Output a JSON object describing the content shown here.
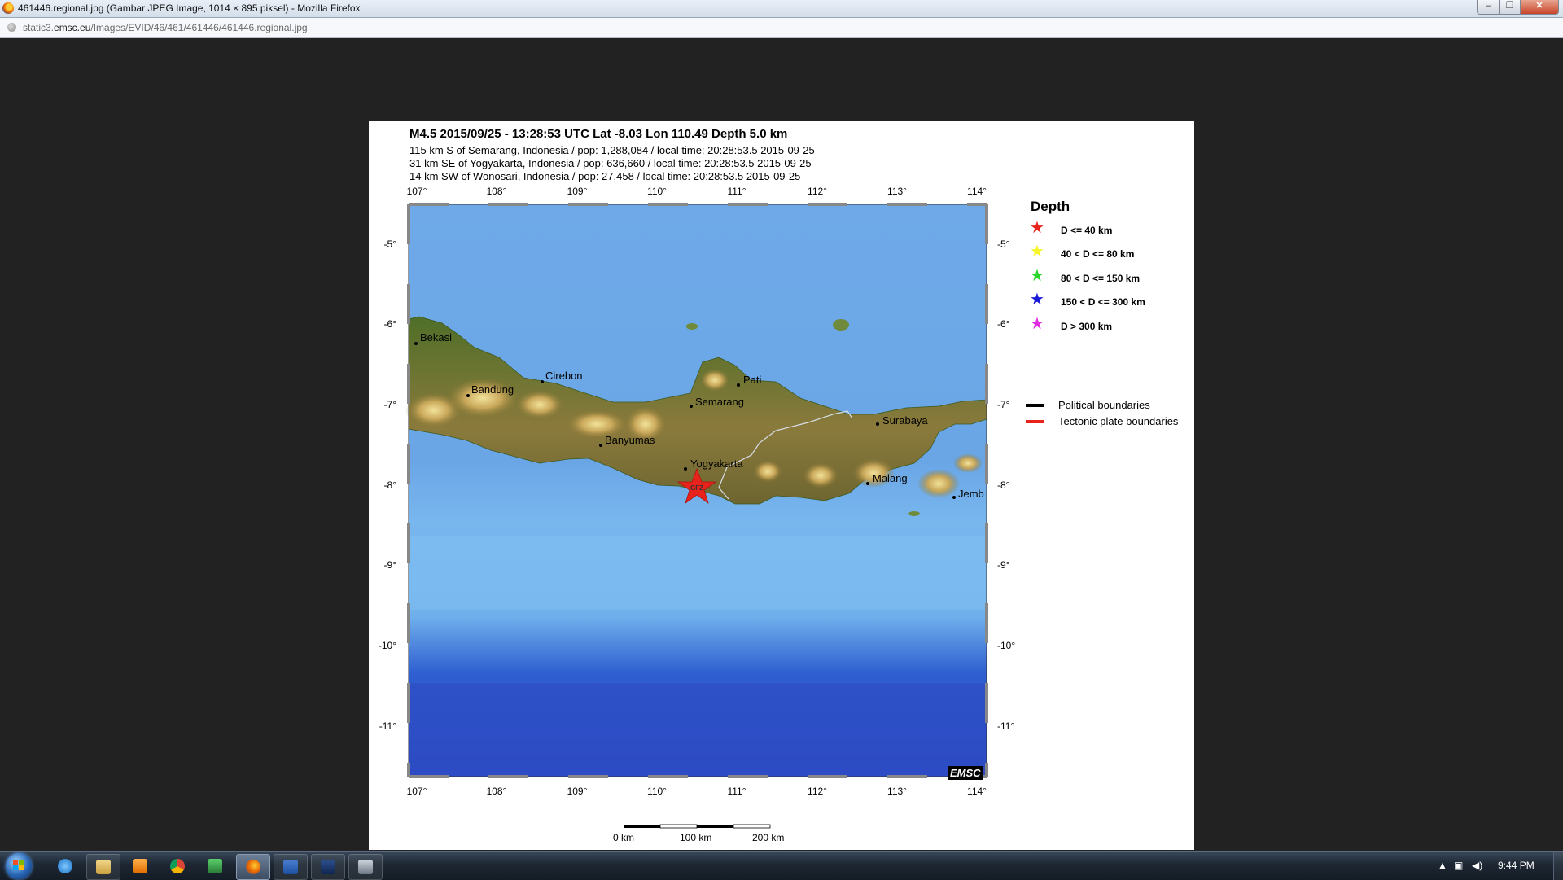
{
  "window": {
    "title": "461446.regional.jpg (Gambar JPEG Image, 1014 × 895 piksel) - Mozilla Firefox",
    "buttons": {
      "minimize": "–",
      "maximize": "❐",
      "close": "✕"
    }
  },
  "address": {
    "url_prefix": "static3.",
    "url_domain": "emsc.eu",
    "url_path": "/Images/EVID/46/461/461446/461446.regional.jpg"
  },
  "map": {
    "headline": "M4.5  2015/09/25 - 13:28:53 UTC   Lat -8.03  Lon 110.49    Depth   5.0 km",
    "lines": [
      "115 km S of Semarang, Indonesia / pop: 1,288,084 / local time: 20:28:53.5 2015-09-25",
      "31 km SE of Yogyakarta, Indonesia / pop: 636,660 / local time: 20:28:53.5 2015-09-25",
      "14 km SW of Wonosari, Indonesia / pop: 27,458 / local time: 20:28:53.5 2015-09-25"
    ],
    "lon_ticks": [
      "107°",
      "108°",
      "109°",
      "110°",
      "111°",
      "112°",
      "113°",
      "114°"
    ],
    "lat_ticks": [
      "-5°",
      "-6°",
      "-7°",
      "-8°",
      "-9°",
      "-10°",
      "-11°"
    ],
    "cities": [
      "Bekasi",
      "Cirebon",
      "Bandung",
      "Pati",
      "Semarang",
      "Surabaya",
      "Banyumas",
      "Yogyakarta",
      "Malang",
      "Jemb"
    ],
    "epicenter_label": "GFZ",
    "watermark": "EMSC",
    "legend": {
      "title": "Depth",
      "items": [
        {
          "label": "D <= 40 km",
          "color": "#e8231c"
        },
        {
          "label": "40 < D <= 80 km",
          "color": "#f5f52a"
        },
        {
          "label": "80 < D <= 150 km",
          "color": "#2ad62a"
        },
        {
          "label": "150 < D <= 300 km",
          "color": "#1a1ad6"
        },
        {
          "label": "D > 300 km",
          "color": "#e22ae2"
        }
      ],
      "lines": [
        {
          "label": "Political boundaries",
          "color": "#000000"
        },
        {
          "label": "Tectonic plate boundaries",
          "color": "#e8231c"
        }
      ]
    },
    "scale": [
      "0 km",
      "100 km",
      "200 km"
    ]
  },
  "taskbar": {
    "clock": "9:44 PM",
    "tray_arrow": "▲"
  }
}
